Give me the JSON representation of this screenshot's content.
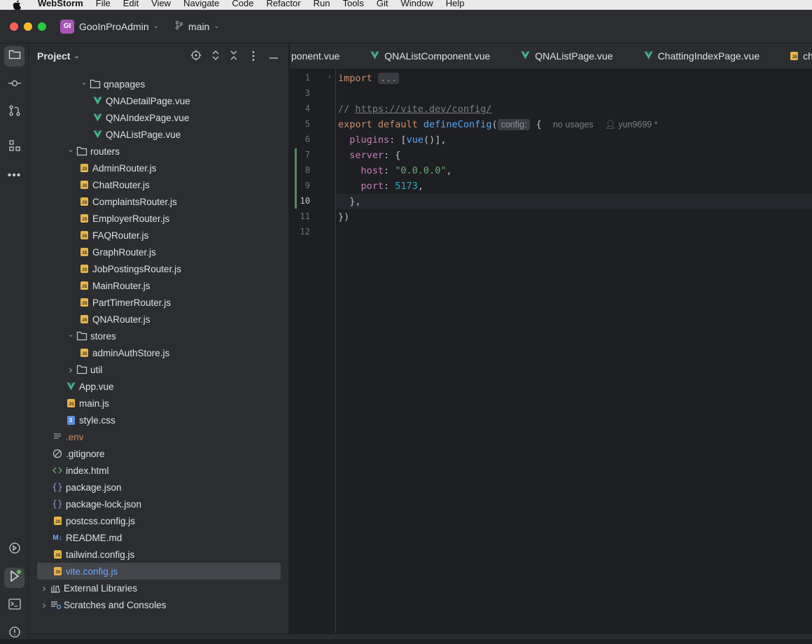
{
  "menubar": {
    "app_name": "WebStorm",
    "items": [
      "File",
      "Edit",
      "View",
      "Navigate",
      "Code",
      "Refactor",
      "Run",
      "Tools",
      "Git",
      "Window",
      "Help"
    ]
  },
  "titlebar": {
    "project_initials": "GI",
    "project_name": "GooInProAdmin",
    "branch": "main",
    "colors": {
      "close": "#ff5f57",
      "minimize": "#febc2e",
      "maximize": "#28c840",
      "badge": "#a855b6"
    }
  },
  "toolstrip": {
    "top": [
      "folder-icon",
      "commit-icon",
      "pull-requests-icon",
      "structure-icon",
      "more-icon"
    ],
    "bottom": [
      "services-icon",
      "run-icon",
      "terminal-icon",
      "problems-icon"
    ]
  },
  "project_panel": {
    "title": "Project",
    "tree": [
      {
        "label": "qnapages",
        "type": "folder",
        "indent": 3,
        "arrow": "open"
      },
      {
        "label": "QNADetailPage.vue",
        "type": "vue",
        "indent": 4
      },
      {
        "label": "QNAIndexPage.vue",
        "type": "vue",
        "indent": 4
      },
      {
        "label": "QNAListPage.vue",
        "type": "vue",
        "indent": 4
      },
      {
        "label": "routers",
        "type": "folder",
        "indent": 2,
        "arrow": "open"
      },
      {
        "label": "AdminRouter.js",
        "type": "js",
        "indent": 3
      },
      {
        "label": "ChatRouter.js",
        "type": "js",
        "indent": 3
      },
      {
        "label": "ComplaintsRouter.js",
        "type": "js",
        "indent": 3
      },
      {
        "label": "EmployerRouter.js",
        "type": "js",
        "indent": 3
      },
      {
        "label": "FAQRouter.js",
        "type": "js",
        "indent": 3
      },
      {
        "label": "GraphRouter.js",
        "type": "js",
        "indent": 3
      },
      {
        "label": "JobPostingsRouter.js",
        "type": "js",
        "indent": 3
      },
      {
        "label": "MainRouter.js",
        "type": "js",
        "indent": 3
      },
      {
        "label": "PartTimerRouter.js",
        "type": "js",
        "indent": 3
      },
      {
        "label": "QNARouter.js",
        "type": "js",
        "indent": 3
      },
      {
        "label": "stores",
        "type": "folder",
        "indent": 2,
        "arrow": "open"
      },
      {
        "label": "adminAuthStore.js",
        "type": "js",
        "indent": 3
      },
      {
        "label": "util",
        "type": "folder",
        "indent": 2,
        "arrow": "closed"
      },
      {
        "label": "App.vue",
        "type": "vue",
        "indent": 2
      },
      {
        "label": "main.js",
        "type": "js",
        "indent": 2
      },
      {
        "label": "style.css",
        "type": "css",
        "indent": 2
      },
      {
        "label": ".env",
        "type": "env",
        "indent": 1
      },
      {
        "label": ".gitignore",
        "type": "ignore",
        "indent": 1
      },
      {
        "label": "index.html",
        "type": "html",
        "indent": 1
      },
      {
        "label": "package.json",
        "type": "json",
        "indent": 1
      },
      {
        "label": "package-lock.json",
        "type": "json",
        "indent": 1
      },
      {
        "label": "postcss.config.js",
        "type": "js",
        "indent": 1
      },
      {
        "label": "README.md",
        "type": "md",
        "indent": 1
      },
      {
        "label": "tailwind.config.js",
        "type": "js",
        "indent": 1
      },
      {
        "label": "vite.config.js",
        "type": "js",
        "indent": 1,
        "selected": true
      },
      {
        "label": "External Libraries",
        "type": "lib",
        "indent": 0,
        "arrow": "closed"
      },
      {
        "label": "Scratches and Consoles",
        "type": "scratch",
        "indent": 0,
        "arrow": "closed"
      }
    ]
  },
  "tabs": [
    {
      "label": "ponent.vue",
      "type": "none"
    },
    {
      "label": "QNAListComponent.vue",
      "type": "vue"
    },
    {
      "label": "QNAListPage.vue",
      "type": "vue"
    },
    {
      "label": "ChattingIndexPage.vue",
      "type": "vue"
    },
    {
      "label": "chatA",
      "type": "js"
    }
  ],
  "editor": {
    "line_numbers": [
      "1",
      "3",
      "4",
      "5",
      "6",
      "7",
      "8",
      "9",
      "10",
      "11",
      "12"
    ],
    "current_line": "10",
    "import_kw": "import",
    "import_fold": "...",
    "comment_prefix": "// ",
    "comment_url": "https://vite.dev/config/",
    "l5_export": "export default ",
    "l5_fn": "defineConfig",
    "l5_paren": "(",
    "l5_hint": "config:",
    "l5_brace": " {",
    "l5_usages": "no usages",
    "l5_author": "yun9699 *",
    "l6_prop": "plugins",
    "l6_a": ": [",
    "l6_fn": "vue",
    "l6_b": "()],",
    "l7_prop": "server",
    "l7_a": ": {",
    "l8_prop": "host",
    "l8_a": ": ",
    "l8_str": "\"0.0.0.0\"",
    "l8_b": ",",
    "l9_prop": "port",
    "l9_a": ": ",
    "l9_num": "5173",
    "l9_b": ",",
    "l10": "},",
    "l11": "})"
  }
}
